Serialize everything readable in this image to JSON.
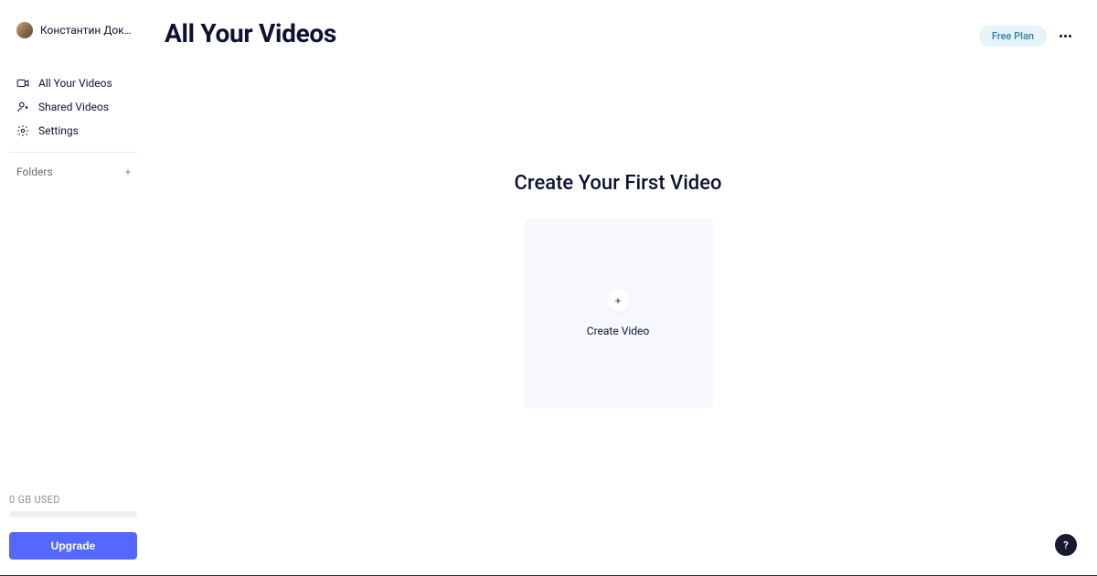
{
  "user": {
    "name": "Константин Докуч..."
  },
  "sidebar": {
    "items": [
      {
        "label": "All Your Videos",
        "icon": "video-icon"
      },
      {
        "label": "Shared Videos",
        "icon": "person-share-icon"
      },
      {
        "label": "Settings",
        "icon": "gear-icon"
      }
    ],
    "folders_label": "Folders"
  },
  "storage": {
    "used_label": "0 GB USED"
  },
  "actions": {
    "upgrade_label": "Upgrade"
  },
  "header": {
    "title": "All Your Videos",
    "plan_badge": "Free Plan"
  },
  "empty": {
    "title": "Create Your First Video",
    "create_label": "Create Video"
  },
  "help": {
    "label": "?"
  }
}
